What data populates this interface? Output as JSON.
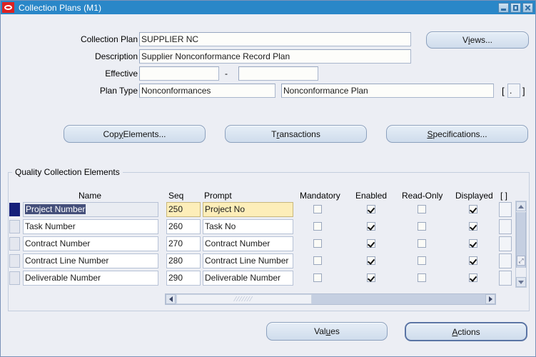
{
  "window": {
    "title": "Collection Plans (M1)",
    "logo_icon": "oracle-logo-icon",
    "controls": {
      "minimize": "minimize-icon",
      "maximize": "maximize-icon",
      "close": "close-icon"
    },
    "titlebar_color": "#2a87c8",
    "background_color": "#eceef4"
  },
  "form": {
    "fields": [
      {
        "label": "Collection Plan",
        "value": "SUPPLIER NC"
      },
      {
        "label": "Description",
        "value": "Supplier Nonconformance Record Plan"
      },
      {
        "label": "Effective",
        "value": "",
        "value2": "",
        "separator": "-"
      },
      {
        "label": "Plan Type",
        "value": "Nonconformances",
        "value2": "Nonconformance Plan"
      }
    ],
    "plan_type_flag": ".",
    "bracket_open": "[",
    "bracket_close": "]"
  },
  "buttons": {
    "views": {
      "pre": "V",
      "mn": "i",
      "post": "ews..."
    },
    "copy_elements": {
      "pre": "Cop",
      "mn": "y",
      "post": " Elements..."
    },
    "transactions": {
      "pre": "T",
      "mn": "r",
      "post": "ansactions"
    },
    "specifications": {
      "pre": "",
      "mn": "S",
      "post": "pecifications..."
    },
    "values": {
      "pre": "Val",
      "mn": "u",
      "post": "es"
    },
    "actions": {
      "pre": "",
      "mn": "A",
      "post": "ctions"
    }
  },
  "elements_block": {
    "title": "Quality Collection Elements",
    "headers": {
      "name": "Name",
      "seq": "Seq",
      "prompt": "Prompt",
      "mandatory": "Mandatory",
      "enabled": "Enabled",
      "read_only": "Read-Only",
      "displayed": "Displayed",
      "extra": "[ ]"
    },
    "rows": [
      {
        "name": "Project Number",
        "seq": "250",
        "prompt": "Project No",
        "mandatory": false,
        "enabled": true,
        "read_only": false,
        "displayed": true,
        "selected": true
      },
      {
        "name": "Task Number",
        "seq": "260",
        "prompt": "Task No",
        "mandatory": false,
        "enabled": true,
        "read_only": false,
        "displayed": true,
        "selected": false
      },
      {
        "name": "Contract Number",
        "seq": "270",
        "prompt": "Contract Number",
        "mandatory": false,
        "enabled": true,
        "read_only": false,
        "displayed": true,
        "selected": false
      },
      {
        "name": "Contract Line Number",
        "seq": "280",
        "prompt": "Contract Line Number",
        "mandatory": false,
        "enabled": true,
        "read_only": false,
        "displayed": true,
        "selected": false
      },
      {
        "name": "Deliverable Number",
        "seq": "290",
        "prompt": "Deliverable Number",
        "mandatory": false,
        "enabled": true,
        "read_only": false,
        "displayed": true,
        "selected": false
      }
    ]
  }
}
